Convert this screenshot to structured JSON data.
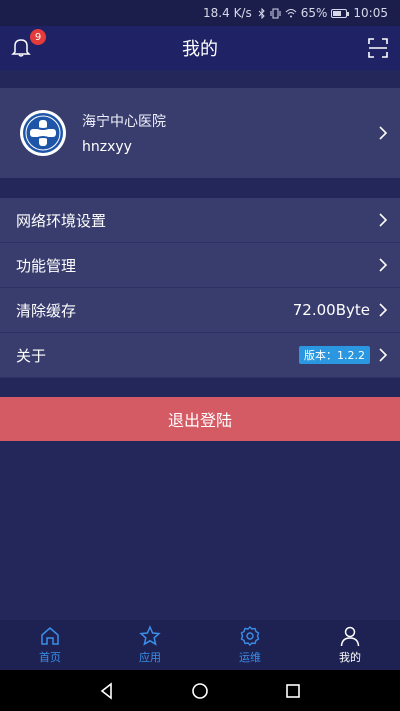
{
  "status_bar": {
    "net_speed": "18.4 K/s",
    "battery": "65%",
    "battery_level": 0.65,
    "time": "10:05"
  },
  "header": {
    "title": "我的",
    "notification_count": "9"
  },
  "hospital": {
    "name": "海宁中心医院",
    "username": "hnzxyy"
  },
  "menu": [
    {
      "label": "网络环境设置",
      "value": ""
    },
    {
      "label": "功能管理",
      "value": ""
    },
    {
      "label": "清除缓存",
      "value": "72.00Byte"
    },
    {
      "label": "关于",
      "value": "版本：1.2.2"
    }
  ],
  "logout_label": "退出登陆",
  "tabs": [
    {
      "label": "首页",
      "icon": "home-icon"
    },
    {
      "label": "应用",
      "icon": "star-icon"
    },
    {
      "label": "运维",
      "icon": "gear-icon"
    },
    {
      "label": "我的",
      "icon": "user-icon"
    }
  ],
  "colors": {
    "background": "#23275a",
    "header": "#1f2366",
    "card": "#393d6e",
    "logout": "#d45a64",
    "tab_active_blue": "#3a8ee8",
    "badge": "#e43b3b",
    "version_badge": "#2a97e0"
  }
}
